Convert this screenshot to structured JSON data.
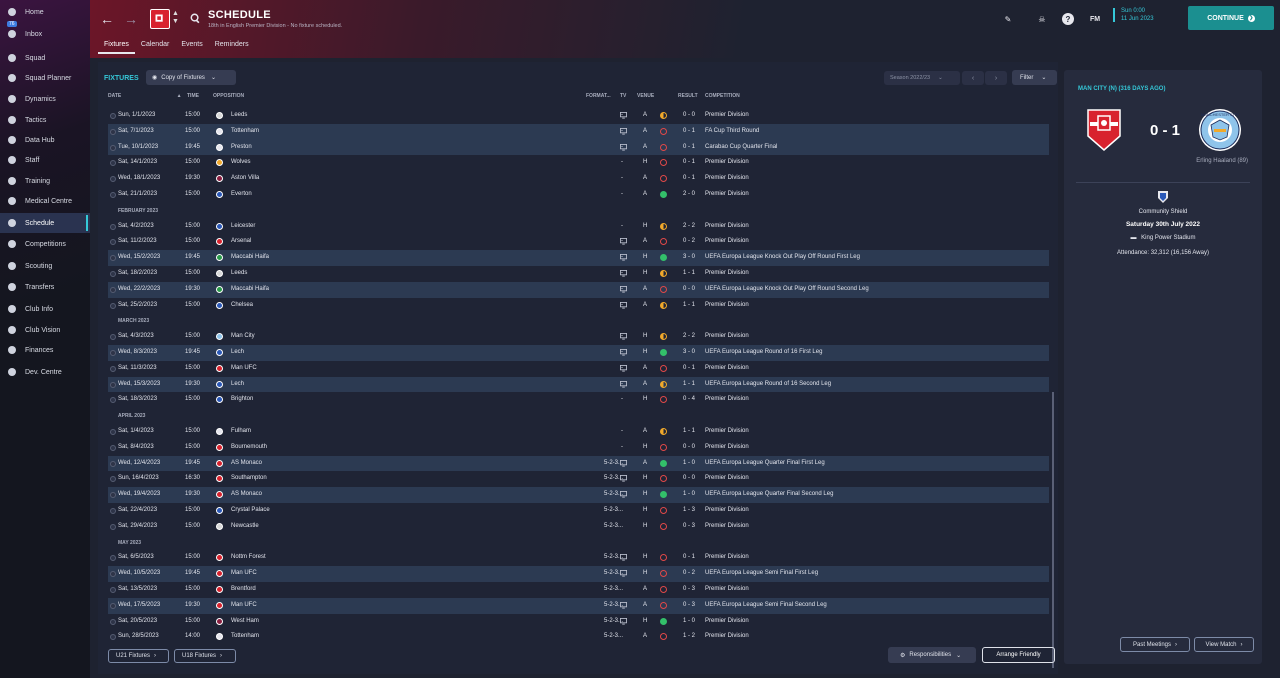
{
  "sidebar": {
    "items": [
      {
        "label": "Home",
        "icon": "home-icon"
      },
      {
        "label": "Inbox",
        "icon": "inbox-icon",
        "badge": "76"
      },
      {
        "label": "Squad",
        "icon": "squad-icon"
      },
      {
        "label": "Squad Planner",
        "icon": "squad-planner-icon"
      },
      {
        "label": "Dynamics",
        "icon": "dynamics-icon"
      },
      {
        "label": "Tactics",
        "icon": "tactics-icon"
      },
      {
        "label": "Data Hub",
        "icon": "data-hub-icon"
      },
      {
        "label": "Staff",
        "icon": "staff-icon"
      },
      {
        "label": "Training",
        "icon": "training-icon"
      },
      {
        "label": "Medical Centre",
        "icon": "medical-icon"
      },
      {
        "label": "Schedule",
        "icon": "schedule-icon"
      },
      {
        "label": "Competitions",
        "icon": "trophy-icon"
      },
      {
        "label": "Scouting",
        "icon": "scouting-icon"
      },
      {
        "label": "Transfers",
        "icon": "transfers-icon"
      },
      {
        "label": "Club Info",
        "icon": "club-info-icon"
      },
      {
        "label": "Club Vision",
        "icon": "club-vision-icon"
      },
      {
        "label": "Finances",
        "icon": "finances-icon"
      },
      {
        "label": "Dev. Centre",
        "icon": "dev-centre-icon"
      }
    ]
  },
  "header": {
    "title": "SCHEDULE",
    "subtitle": "18th in English Premier Division - No fixture scheduled.",
    "tabs": [
      "Fixtures",
      "Calendar",
      "Events",
      "Reminders"
    ],
    "fm_label": "FM",
    "date_time": "Sun 0:00",
    "date_day": "11 Jun 2023",
    "continue_label": "CONTINUE"
  },
  "fixtures": {
    "title": "FIXTURES",
    "view_select": "Copy of Fixtures",
    "season": "Season 2022/23",
    "filter_label": "Filter",
    "columns": {
      "date": "DATE",
      "time": "TIME",
      "opposition": "OPPOSITION",
      "formation": "FORMAT...",
      "tv": "TV",
      "venue": "VENUE",
      "result": "RESULT",
      "competition": "COMPETITION"
    },
    "rows": [
      {
        "date": "Sun, 1/1/2023",
        "time": "15:00",
        "opp": "Leeds",
        "crest": "#d9d9d9",
        "form": "-",
        "tv": true,
        "venue": "A",
        "res": "d",
        "score": "0 - 0",
        "comp": "Premier Division"
      },
      {
        "date": "Sat, 7/1/2023",
        "time": "15:00",
        "opp": "Tottenham",
        "crest": "#e6e6ee",
        "form": "-",
        "tv": true,
        "venue": "A",
        "res": "l",
        "score": "0 - 1",
        "comp": "FA Cup Third Round",
        "hl": true
      },
      {
        "date": "Tue, 10/1/2023",
        "time": "19:45",
        "opp": "Preston",
        "crest": "#e6e6ee",
        "form": "-",
        "tv": true,
        "venue": "A",
        "res": "l",
        "score": "0 - 1",
        "comp": "Carabao Cup Quarter Final",
        "hl": true
      },
      {
        "date": "Sat, 14/1/2023",
        "time": "15:00",
        "opp": "Wolves",
        "crest": "#f1a92b",
        "form": "-",
        "tv": false,
        "venue": "H",
        "res": "l",
        "score": "0 - 1",
        "comp": "Premier Division"
      },
      {
        "date": "Wed, 18/1/2023",
        "time": "19:30",
        "opp": "Aston Villa",
        "crest": "#8a1e40",
        "form": "-",
        "tv": false,
        "venue": "A",
        "res": "l",
        "score": "0 - 1",
        "comp": "Premier Division"
      },
      {
        "date": "Sat, 21/1/2023",
        "time": "15:00",
        "opp": "Everton",
        "crest": "#2a58b8",
        "form": "-",
        "tv": false,
        "venue": "A",
        "res": "w",
        "score": "2 - 0",
        "comp": "Premier Division"
      },
      {
        "month": "FEBRUARY 2023"
      },
      {
        "date": "Sat, 4/2/2023",
        "time": "15:00",
        "opp": "Leicester",
        "crest": "#2a58b8",
        "form": "-",
        "tv": false,
        "venue": "H",
        "res": "d",
        "score": "2 - 2",
        "comp": "Premier Division"
      },
      {
        "date": "Sat, 11/2/2023",
        "time": "15:00",
        "opp": "Arsenal",
        "crest": "#d8222e",
        "form": "-",
        "tv": true,
        "venue": "A",
        "res": "l",
        "score": "0 - 2",
        "comp": "Premier Division"
      },
      {
        "date": "Wed, 15/2/2023",
        "time": "19:45",
        "opp": "Maccabi Haifa",
        "crest": "#2a9a4a",
        "form": "-",
        "tv": true,
        "venue": "H",
        "res": "w",
        "score": "3 - 0",
        "comp": "UEFA Europa League Knock Out Play Off Round First Leg",
        "hl": true
      },
      {
        "date": "Sat, 18/2/2023",
        "time": "15:00",
        "opp": "Leeds",
        "crest": "#d9d9d9",
        "form": "-",
        "tv": true,
        "venue": "H",
        "res": "d",
        "score": "1 - 1",
        "comp": "Premier Division"
      },
      {
        "date": "Wed, 22/2/2023",
        "time": "19:30",
        "opp": "Maccabi Haifa",
        "crest": "#2a9a4a",
        "form": "-",
        "tv": true,
        "venue": "A",
        "res": "l",
        "score": "0 - 0",
        "comp": "UEFA Europa League Knock Out Play Off Round Second Leg",
        "hl": true
      },
      {
        "date": "Sat, 25/2/2023",
        "time": "15:00",
        "opp": "Chelsea",
        "crest": "#2a58b8",
        "form": "-",
        "tv": true,
        "venue": "A",
        "res": "d",
        "score": "1 - 1",
        "comp": "Premier Division"
      },
      {
        "month": "MARCH 2023"
      },
      {
        "date": "Sat, 4/3/2023",
        "time": "15:00",
        "opp": "Man City",
        "crest": "#8fc4ea",
        "form": "-",
        "tv": true,
        "venue": "H",
        "res": "d",
        "score": "2 - 2",
        "comp": "Premier Division"
      },
      {
        "date": "Wed, 8/3/2023",
        "time": "19:45",
        "opp": "Lech",
        "crest": "#2a58b8",
        "form": "-",
        "tv": true,
        "venue": "H",
        "res": "w",
        "score": "3 - 0",
        "comp": "UEFA Europa League Round of 16  First Leg",
        "hl": true
      },
      {
        "date": "Sat, 11/3/2023",
        "time": "15:00",
        "opp": "Man UFC",
        "crest": "#d8222e",
        "form": "-",
        "tv": true,
        "venue": "A",
        "res": "l",
        "score": "0 - 1",
        "comp": "Premier Division"
      },
      {
        "date": "Wed, 15/3/2023",
        "time": "19:30",
        "opp": "Lech",
        "crest": "#2a58b8",
        "form": "-",
        "tv": true,
        "venue": "A",
        "res": "d",
        "score": "1 - 1",
        "comp": "UEFA Europa League Round of 16  Second Leg",
        "hl": true
      },
      {
        "date": "Sat, 18/3/2023",
        "time": "15:00",
        "opp": "Brighton",
        "crest": "#2a58b8",
        "form": "-",
        "tv": false,
        "venue": "H",
        "res": "l",
        "score": "0 - 4",
        "comp": "Premier Division"
      },
      {
        "month": "APRIL 2023"
      },
      {
        "date": "Sat, 1/4/2023",
        "time": "15:00",
        "opp": "Fulham",
        "crest": "#e6e6ee",
        "form": "-",
        "tv": false,
        "venue": "A",
        "res": "d",
        "score": "1 - 1",
        "comp": "Premier Division"
      },
      {
        "date": "Sat, 8/4/2023",
        "time": "15:00",
        "opp": "Bournemouth",
        "crest": "#d8222e",
        "form": "-",
        "tv": false,
        "venue": "H",
        "res": "l",
        "score": "0 - 0",
        "comp": "Premier Division"
      },
      {
        "date": "Wed, 12/4/2023",
        "time": "19:45",
        "opp": "AS Monaco",
        "crest": "#d8222e",
        "form": "5-2-3...",
        "tv": true,
        "venue": "A",
        "res": "w",
        "score": "1 - 0",
        "comp": "UEFA Europa League Quarter Final First Leg",
        "hl": true
      },
      {
        "date": "Sun, 16/4/2023",
        "time": "16:30",
        "opp": "Southampton",
        "crest": "#d8222e",
        "form": "5-2-3...",
        "tv": true,
        "venue": "H",
        "res": "l",
        "score": "0 - 0",
        "comp": "Premier Division"
      },
      {
        "date": "Wed, 19/4/2023",
        "time": "19:30",
        "opp": "AS Monaco",
        "crest": "#d8222e",
        "form": "5-2-3...",
        "tv": true,
        "venue": "H",
        "res": "w",
        "score": "1 - 0",
        "comp": "UEFA Europa League Quarter Final Second Leg",
        "hl": true
      },
      {
        "date": "Sat, 22/4/2023",
        "time": "15:00",
        "opp": "Crystal Palace",
        "crest": "#2a58b8",
        "form": "5-2-3...",
        "tv": false,
        "venue": "H",
        "res": "l",
        "score": "1 - 3",
        "comp": "Premier Division"
      },
      {
        "date": "Sat, 29/4/2023",
        "time": "15:00",
        "opp": "Newcastle",
        "crest": "#d9d9d9",
        "form": "5-2-3...",
        "tv": false,
        "venue": "H",
        "res": "l",
        "score": "0 - 3",
        "comp": "Premier Division"
      },
      {
        "month": "MAY 2023"
      },
      {
        "date": "Sat, 6/5/2023",
        "time": "15:00",
        "opp": "Nottm Forest",
        "crest": "#d8222e",
        "form": "5-2-3...",
        "tv": true,
        "venue": "H",
        "res": "l",
        "score": "0 - 1",
        "comp": "Premier Division"
      },
      {
        "date": "Wed, 10/5/2023",
        "time": "19:45",
        "opp": "Man UFC",
        "crest": "#d8222e",
        "form": "5-2-3...",
        "tv": true,
        "venue": "H",
        "res": "l",
        "score": "0 - 2",
        "comp": "UEFA Europa League Semi Final First Leg",
        "hl": true
      },
      {
        "date": "Sat, 13/5/2023",
        "time": "15:00",
        "opp": "Brentford",
        "crest": "#d8222e",
        "form": "5-2-3...",
        "tv": false,
        "venue": "A",
        "res": "l",
        "score": "0 - 3",
        "comp": "Premier Division"
      },
      {
        "date": "Wed, 17/5/2023",
        "time": "19:30",
        "opp": "Man UFC",
        "crest": "#d8222e",
        "form": "5-2-3...",
        "tv": true,
        "venue": "A",
        "res": "l",
        "score": "0 - 3",
        "comp": "UEFA Europa League Semi Final Second Leg",
        "hl": true
      },
      {
        "date": "Sat, 20/5/2023",
        "time": "15:00",
        "opp": "West Ham",
        "crest": "#8a1e40",
        "form": "5-2-3...",
        "tv": true,
        "venue": "H",
        "res": "w",
        "score": "1 - 0",
        "comp": "Premier Division"
      },
      {
        "date": "Sun, 28/5/2023",
        "time": "14:00",
        "opp": "Tottenham",
        "crest": "#e6e6ee",
        "form": "5-2-3...",
        "tv": false,
        "venue": "A",
        "res": "l",
        "score": "1 - 2",
        "comp": "Premier Division"
      }
    ],
    "footer": {
      "u21_label": "U21 Fixtures",
      "u18_label": "U18 Fixtures",
      "responsibilities_label": "Responsibilities",
      "arrange_friendly_label": "Arrange Friendly"
    }
  },
  "match_panel": {
    "title": "MAN CITY (N) (316 DAYS AGO)",
    "score": "0 - 1",
    "scorer": "Erling Haaland (89)",
    "competition": "Community Shield",
    "date": "Saturday 30th July 2022",
    "stadium": "King Power Stadium",
    "attendance": "Attendance: 32,312 (16,156 Away)",
    "past_meetings_label": "Past Meetings",
    "view_match_label": "View Match",
    "away_badge_text": "MANCHESTER CITY"
  },
  "colors": {
    "accent": "#35c8d8",
    "win": "#33c06a",
    "loss": "#e04848",
    "draw": "#f1a92b",
    "club_red": "#d8222e"
  }
}
